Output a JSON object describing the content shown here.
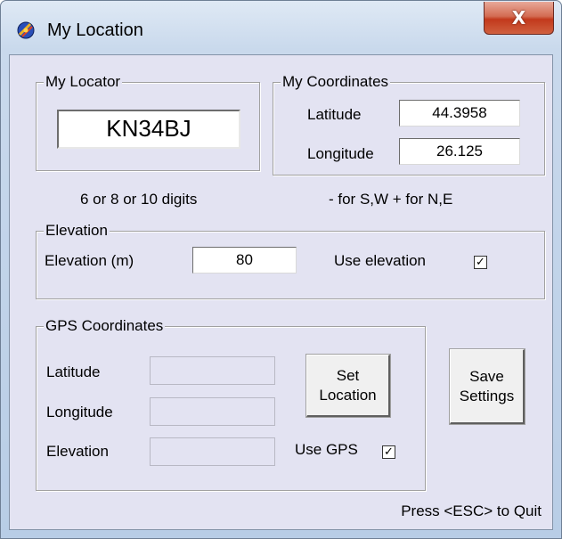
{
  "window": {
    "title": "My Location",
    "close_label": "X"
  },
  "locator": {
    "group_label": "My Locator",
    "value": "KN34BJ",
    "hint": "6 or 8 or 10 digits"
  },
  "coordinates": {
    "group_label": "My Coordinates",
    "latitude_label": "Latitude",
    "latitude_value": "44.3958",
    "longitude_label": "Longitude",
    "longitude_value": "26.125",
    "hint": "- for S,W + for N,E"
  },
  "elevation": {
    "group_label": "Elevation",
    "label": "Elevation (m)",
    "value": "80",
    "use_label": "Use elevation",
    "use_checked": true
  },
  "gps": {
    "group_label": "GPS Coordinates",
    "latitude_label": "Latitude",
    "latitude_value": "",
    "longitude_label": "Longitude",
    "longitude_value": "",
    "elevation_label": "Elevation",
    "elevation_value": "",
    "use_label": "Use GPS",
    "use_checked": true
  },
  "buttons": {
    "set_location": "Set\nLocation",
    "save_settings": "Save\nSettings"
  },
  "footer": {
    "quit_hint": "Press <ESC> to Quit"
  }
}
